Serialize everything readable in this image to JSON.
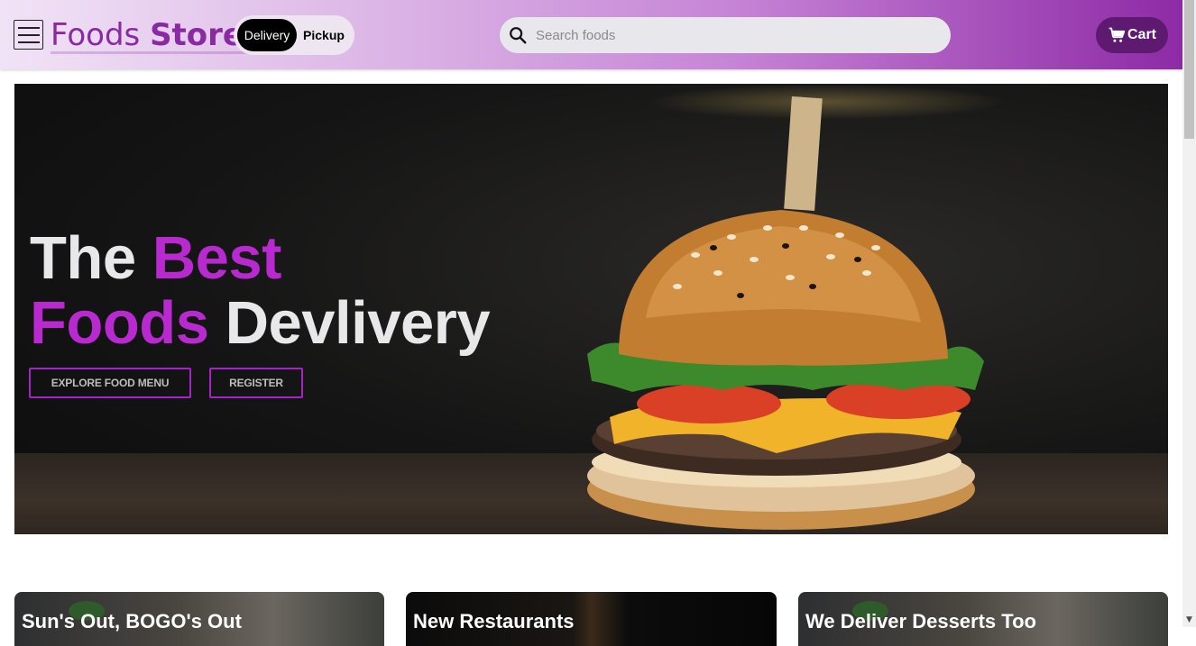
{
  "header": {
    "brand_light": "Foods",
    "brand_strong": "Store",
    "toggle": {
      "active": "Delivery",
      "inactive": "Pickup"
    },
    "search": {
      "placeholder": "Search foods",
      "value": ""
    },
    "cart_label": "Cart"
  },
  "hero": {
    "title_line1_a": "The",
    "title_line1_b": "Best",
    "title_line2_a": "Foods",
    "title_line2_b": "Devlivery",
    "buttons": {
      "explore": "EXPLORE FOOD MENU",
      "register": "REGISTER"
    }
  },
  "cards": [
    {
      "title": "Sun's Out, BOGO's Out"
    },
    {
      "title": "New Restaurants"
    },
    {
      "title": "We Deliver Desserts Too"
    }
  ],
  "colors": {
    "accent": "#b82ad0",
    "brand": "#8a2aa3",
    "cart_bg": "#5e1a70"
  },
  "icons": {
    "menu": "hamburger-menu-icon",
    "search": "search-icon",
    "cart": "cart-icon"
  }
}
